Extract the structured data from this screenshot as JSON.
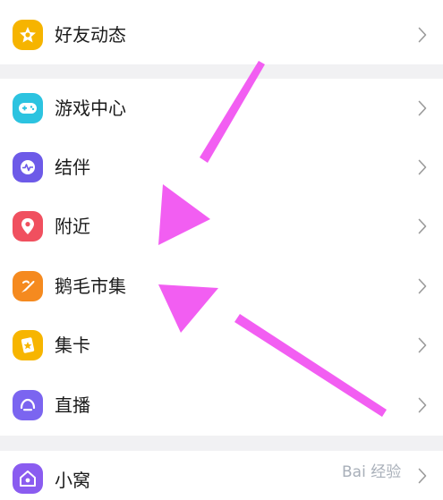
{
  "menu": {
    "items": [
      {
        "label": "好友动态",
        "icon": "star-bubble-icon",
        "color": "#f6b400"
      },
      {
        "label": "游戏中心",
        "icon": "gamepad-icon",
        "color": "#2cc3e0"
      },
      {
        "label": "结伴",
        "icon": "pulse-chat-icon",
        "color": "#6d5ae8"
      },
      {
        "label": "附近",
        "icon": "location-pin-icon",
        "color": "#f0505f"
      },
      {
        "label": "鹅毛市集",
        "icon": "feather-icon",
        "color": "#f58a1f"
      },
      {
        "label": "集卡",
        "icon": "card-icon",
        "color": "#f7b500"
      },
      {
        "label": "直播",
        "icon": "live-icon",
        "color": "#7b65f0"
      },
      {
        "label": "小窝",
        "icon": "home-icon",
        "color": "#8a5cf0"
      }
    ]
  },
  "annotation": {
    "arrow_color": "#f25ef2"
  },
  "watermark": {
    "text": "Bai 经验"
  }
}
